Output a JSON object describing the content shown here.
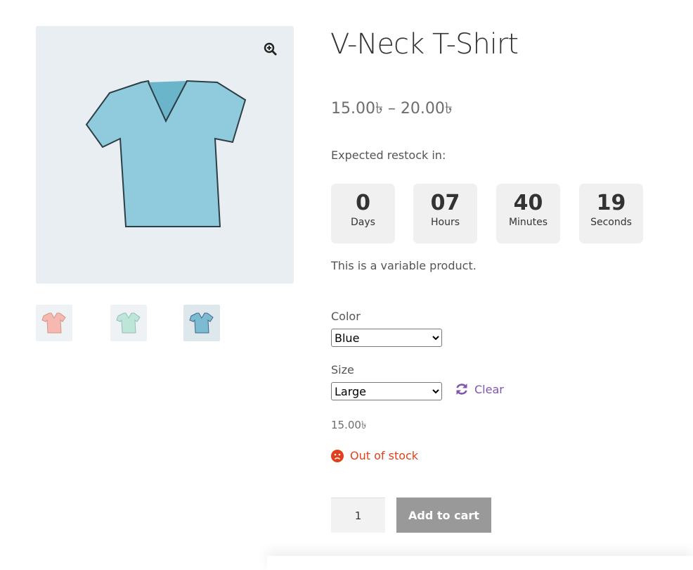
{
  "product": {
    "title": "V-Neck T-Shirt",
    "price_range": "15.00৳  – 20.00৳",
    "description": "This is a variable product."
  },
  "gallery": {
    "main_color": "#8fcbdc",
    "thumbnails": [
      {
        "name": "pink",
        "color": "#f6b8b0"
      },
      {
        "name": "mint",
        "color": "#bde6d8"
      },
      {
        "name": "blue",
        "color": "#7cbcd2"
      }
    ],
    "zoom_icon": "zoom-in-icon"
  },
  "countdown": {
    "label": "Expected restock in:",
    "units": [
      {
        "value": "0",
        "label": "Days"
      },
      {
        "value": "07",
        "label": "Hours"
      },
      {
        "value": "40",
        "label": "Minutes"
      },
      {
        "value": "19",
        "label": "Seconds"
      }
    ]
  },
  "variations": {
    "color_label": "Color",
    "color_value": "Blue",
    "size_label": "Size",
    "size_value": "Large",
    "clear_label": "Clear"
  },
  "variation_price": "15.00৳",
  "stock_status": "Out of stock",
  "cart": {
    "quantity": "1",
    "add_label": "Add to cart"
  },
  "colors": {
    "accent": "#7f54b3",
    "out_of_stock": "#e2401c",
    "button": "#999999"
  }
}
